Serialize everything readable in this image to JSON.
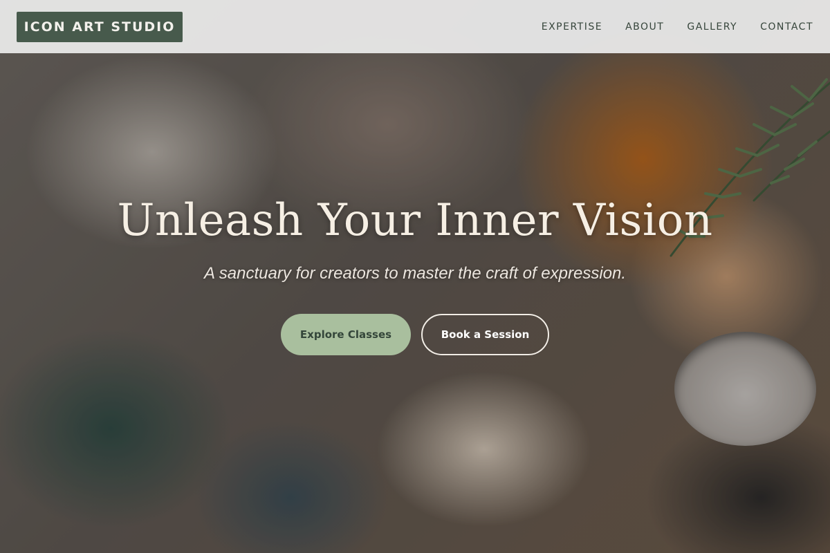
{
  "header": {
    "logo": "ICON ART STUDIO",
    "nav": [
      {
        "label": "EXPERTISE"
      },
      {
        "label": "ABOUT"
      },
      {
        "label": "GALLERY"
      },
      {
        "label": "CONTACT"
      }
    ]
  },
  "hero": {
    "title": "Unleash Your Inner Vision",
    "subtitle": "A sanctuary for creators to master the craft of expression.",
    "primary_button": "Explore Classes",
    "secondary_button": "Book a Session"
  },
  "colors": {
    "brand_green": "#475a4c",
    "button_sage": "#a9bf9e",
    "title_cream": "#f6efe4"
  }
}
